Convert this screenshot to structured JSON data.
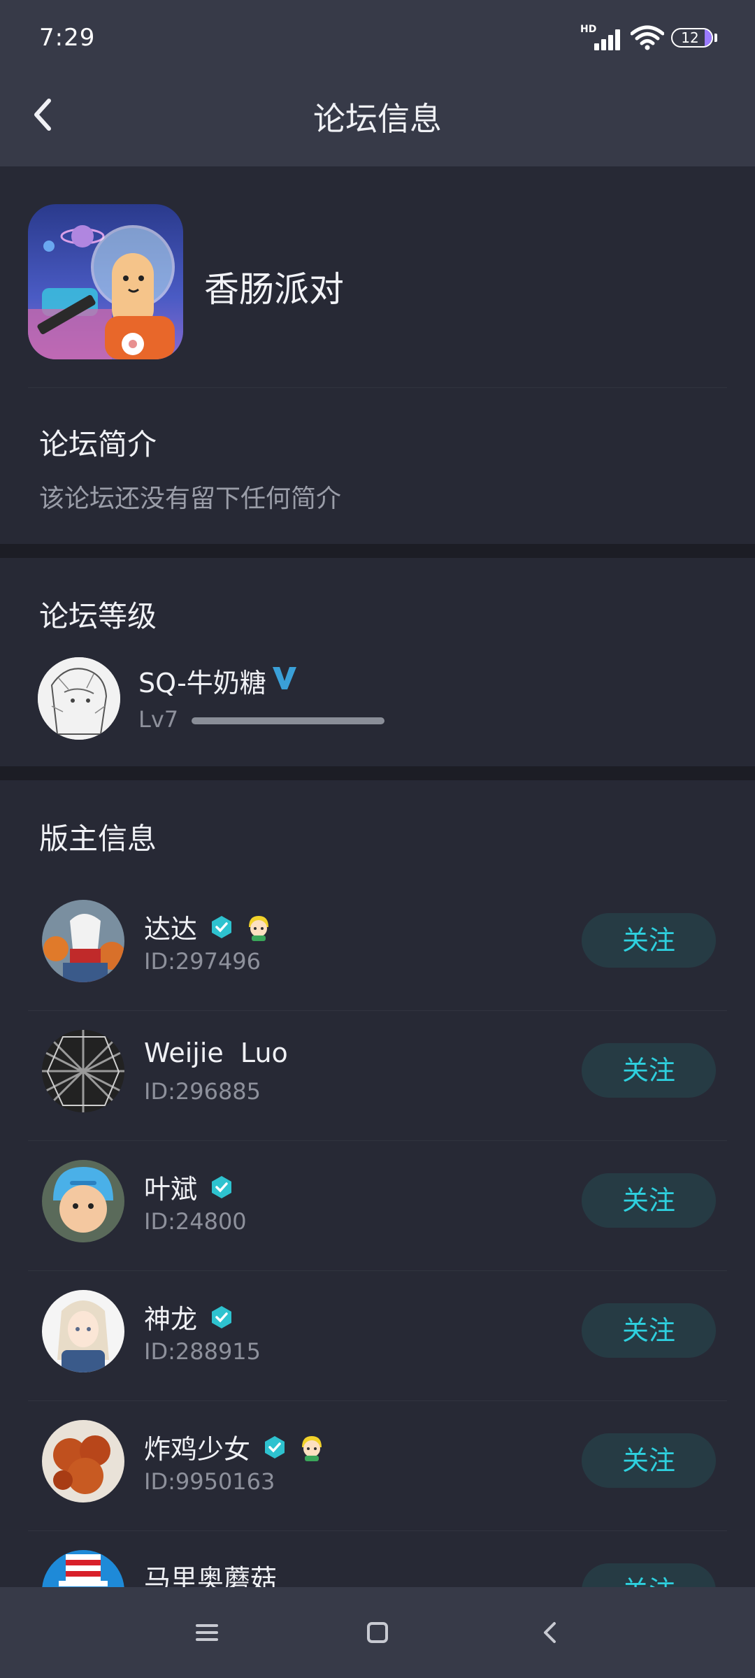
{
  "status_bar": {
    "time": "7:29",
    "network": "HD",
    "battery": "12",
    "icons": [
      "signal-icon",
      "wifi-icon",
      "battery-icon"
    ]
  },
  "header": {
    "title": "论坛信息",
    "back_icon": "chevron-left-icon"
  },
  "forum": {
    "name": "香肠派对",
    "intro_title": "论坛简介",
    "intro_text": "该论坛还没有留下任何简介"
  },
  "level_section": {
    "title": "论坛等级",
    "user_name": "SQ-牛奶糖",
    "level": "Lv7",
    "progress": 1.0,
    "badge_icon": "vip-v-icon"
  },
  "moderators_section": {
    "title": "版主信息",
    "follow_label": "关注",
    "moderators": [
      {
        "name": "达达",
        "id": "ID:297496",
        "verified": true,
        "badge": true
      },
      {
        "name": "Weijie  Luo",
        "id": "ID:296885",
        "verified": false,
        "badge": false
      },
      {
        "name": "叶斌",
        "id": "ID:24800",
        "verified": true,
        "badge": false
      },
      {
        "name": "神龙",
        "id": "ID:288915",
        "verified": true,
        "badge": false
      },
      {
        "name": "炸鸡少女",
        "id": "ID:9950163",
        "verified": true,
        "badge": true
      },
      {
        "name": "马里奥蘑菇",
        "id": "",
        "verified": false,
        "badge": false
      }
    ]
  },
  "nav_bar": {
    "icons": [
      "menu-icon",
      "home-icon",
      "back-icon"
    ]
  },
  "colors": {
    "accent": "#2ed0de",
    "background": "#272935",
    "header": "#373a48"
  }
}
